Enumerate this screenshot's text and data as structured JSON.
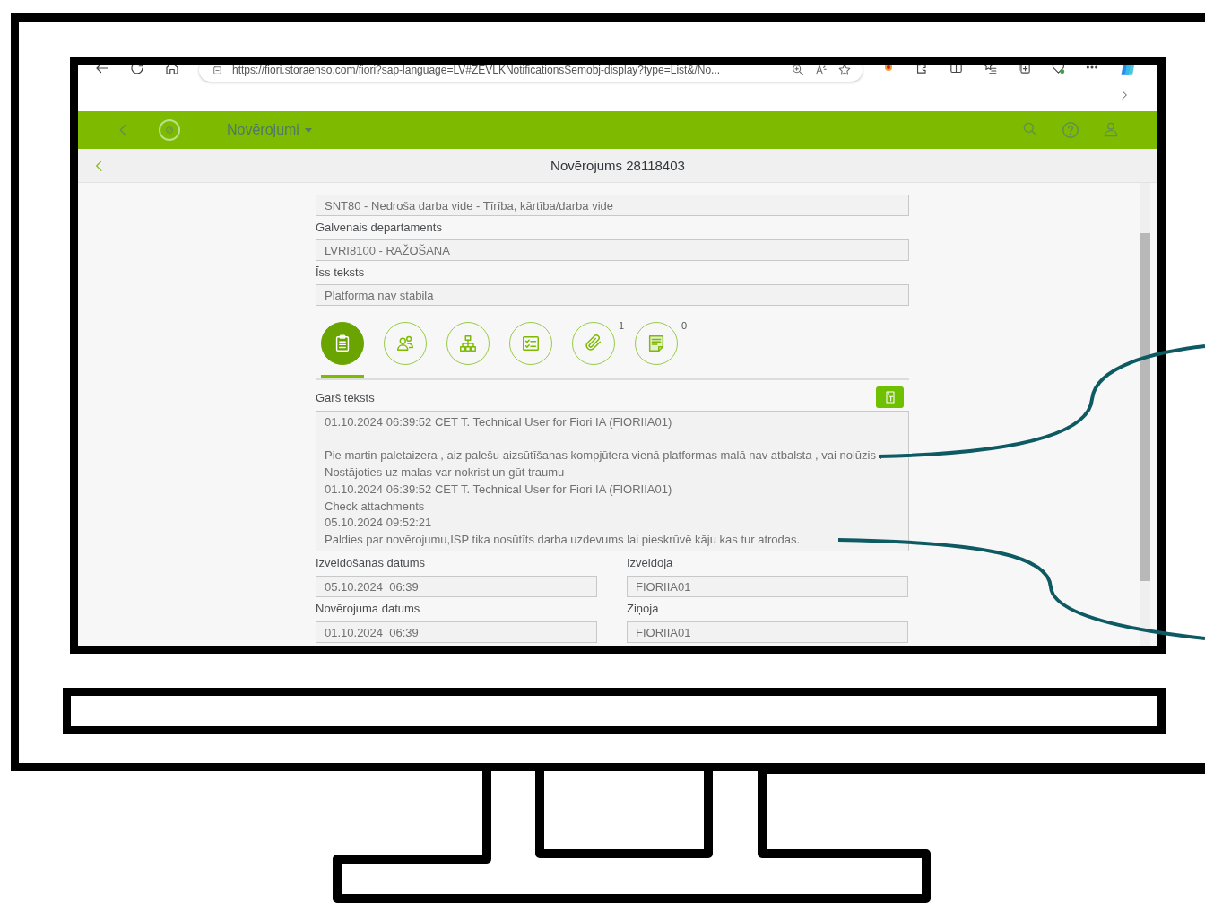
{
  "browser": {
    "url": "https://fiori.storaenso.com/fiori?sap-language=LV#ZEVLKNotificationsSemobj-display?type=List&/No..."
  },
  "shell": {
    "title": "Novērojumi"
  },
  "page": {
    "title": "Novērojums 28118403"
  },
  "top_fields": [
    {
      "value": "SNT80 - Nedroša darba vide - Tīrība, kārtība/darba vide"
    },
    {
      "label": "Galvenais departaments",
      "value": "LVRI8100 - RAŽOŠANA"
    },
    {
      "label": "Īss teksts",
      "value": "Platforma nav stabila"
    }
  ],
  "tabs": [
    {
      "kind": "notes",
      "selected": true
    },
    {
      "kind": "people",
      "selected": false
    },
    {
      "kind": "hierarchy",
      "selected": false
    },
    {
      "kind": "checklist",
      "selected": false
    },
    {
      "kind": "attachment",
      "selected": false,
      "count": "1"
    },
    {
      "kind": "report",
      "selected": false,
      "count": "0"
    }
  ],
  "long_text": {
    "label": "Garš teksts",
    "blocks": [
      [
        "01.10.2024 06:39:52 CET T. Technical User for Fiori IA (FIORIIA01)"
      ],
      [
        "Pie martin paletaizera , aiz palešu aizsūtīšanas kompjūtera vienā platformas malā nav atbalsta , vai nolūzis . Nostājoties uz malas var nokrist un gūt traumu",
        "01.10.2024 06:39:52 CET T. Technical User for Fiori IA (FIORIIA01)",
        "Check attachments",
        "05.10.2024 09:52:21",
        "Paldies par novērojumu,ISP tika nosūtīts darba uzdevums lai pieskrūvē kāju kas tur atrodas."
      ]
    ]
  },
  "detail_fields": [
    {
      "label": "Izveidošanas datums",
      "value": "05.10.2024  06:39"
    },
    {
      "label": "Izveidoja",
      "value": "FIORIIA01"
    },
    {
      "label": "Novērojuma datums",
      "value": "01.10.2024  06:39"
    },
    {
      "label": "Ziņoja",
      "value": "FIORIIA01"
    }
  ]
}
